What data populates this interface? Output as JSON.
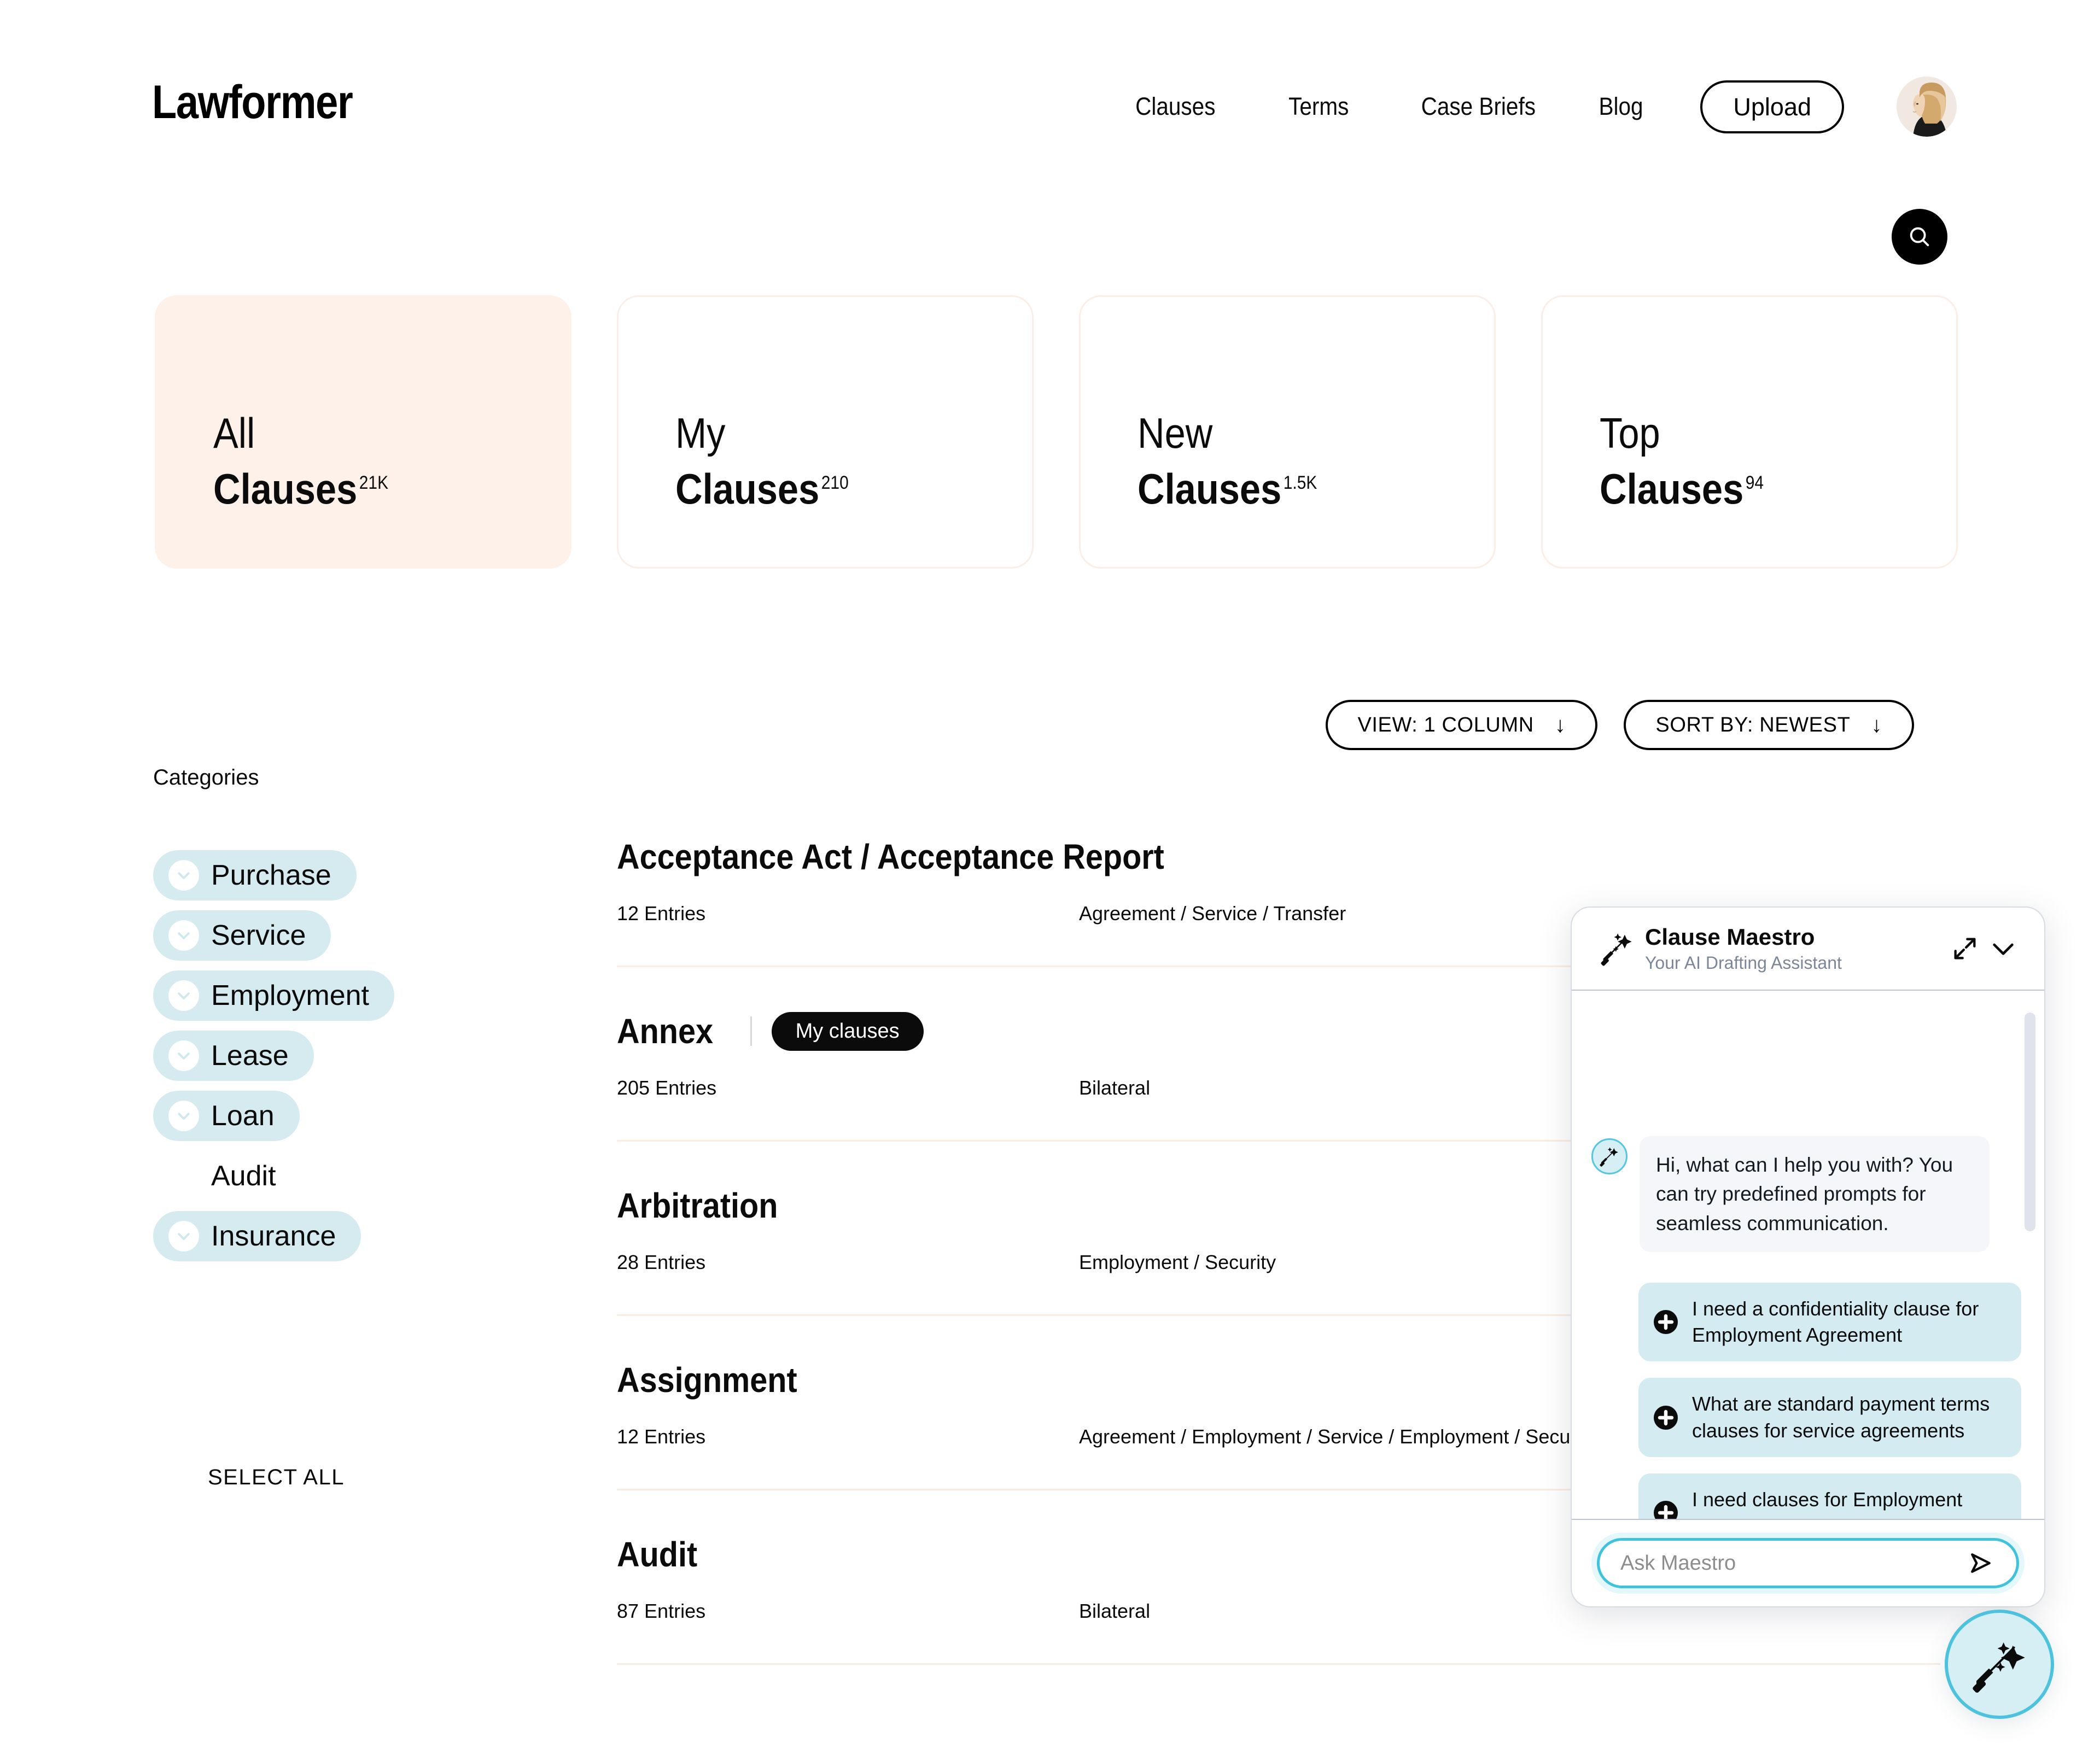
{
  "brand": {
    "logo": "Lawformer"
  },
  "header": {
    "nav": [
      {
        "label": "Clauses"
      },
      {
        "label": "Terms"
      },
      {
        "label": "Case Briefs"
      },
      {
        "label": "Blog"
      }
    ],
    "upload_label": "Upload",
    "avatar_icon": "user-avatar-photo"
  },
  "search": {
    "icon": "search-icon"
  },
  "cards": [
    {
      "line1": "All",
      "line2": "Clauses",
      "count": "21K",
      "active": true
    },
    {
      "line1": "My",
      "line2": "Clauses",
      "count": "210",
      "active": false
    },
    {
      "line1": "New",
      "line2": "Clauses",
      "count": "1.5K",
      "active": false
    },
    {
      "line1": "Top",
      "line2": "Clauses",
      "count": "94",
      "active": false
    }
  ],
  "controls": {
    "view_label": "VIEW: 1 COLUMN",
    "sort_label": "SORT BY: NEWEST",
    "arrow": "↓"
  },
  "categories": {
    "title": "Categories",
    "select_all": "SELECT ALL",
    "items": [
      {
        "label": "Purchase",
        "selected": true
      },
      {
        "label": "Service",
        "selected": true
      },
      {
        "label": "Employment",
        "selected": true
      },
      {
        "label": "Lease",
        "selected": true
      },
      {
        "label": "Loan",
        "selected": true
      },
      {
        "label": "Audit",
        "selected": false
      },
      {
        "label": "Insurance",
        "selected": true
      }
    ]
  },
  "clauses": [
    {
      "title": "Acceptance Act / Acceptance Report",
      "badge": "",
      "entries": "12 Entries",
      "cats": "Agreement / Service / Transfer"
    },
    {
      "title": "Annex",
      "badge": "My clauses",
      "entries": "205 Entries",
      "cats": "Bilateral"
    },
    {
      "title": "Arbitration",
      "badge": "",
      "entries": "28 Entries",
      "cats": "Employment / Security"
    },
    {
      "title": "Assignment",
      "badge": "",
      "entries": "12 Entries",
      "cats": "Agreement / Employment / Service / Employment / Security"
    },
    {
      "title": "Audit",
      "badge": "",
      "entries": "87 Entries",
      "cats": "Bilateral"
    }
  ],
  "chat": {
    "name": "Clause Maestro",
    "subtitle": "Your AI Drafting Assistant",
    "logo_icon": "magic-wand-icon",
    "expand_icon": "expand-diagonal-icon",
    "collapse_icon": "chevron-down-icon",
    "greeting": "Hi, what can I help you with? You can try predefined prompts for seamless communication.",
    "suggestions": [
      {
        "text": "I need a confidentiality clause for Employment Agreement"
      },
      {
        "text": "What are standard payment terms clauses for service agreements"
      },
      {
        "text": "I need clauses for Employment Agreement"
      }
    ],
    "input_placeholder": "Ask Maestro",
    "input_value": "",
    "send_icon": "send-icon"
  },
  "fab": {
    "icon": "magic-wand-icon"
  },
  "colors": {
    "accent_cream": "#fdf1ea",
    "accent_blue": "#d5ebf0",
    "accent_cyan": "#4cc2dc",
    "text": "#0b0b0b",
    "muted": "#7c8699"
  }
}
